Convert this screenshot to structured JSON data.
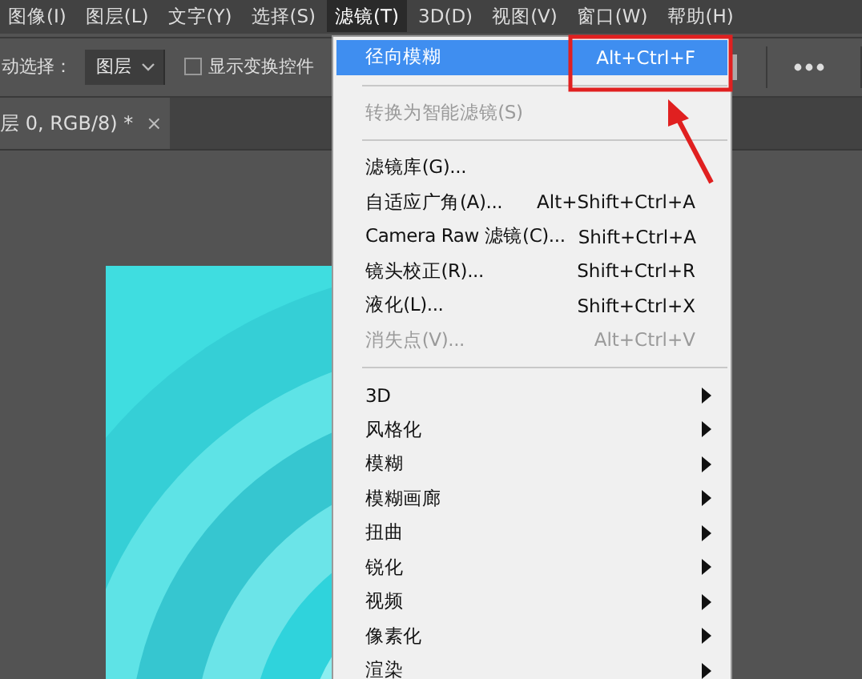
{
  "menubar": [
    {
      "label": "图像(I)",
      "selected": false
    },
    {
      "label": "图层(L)",
      "selected": false
    },
    {
      "label": "文字(Y)",
      "selected": false
    },
    {
      "label": "选择(S)",
      "selected": false
    },
    {
      "label": "滤镜(T)",
      "selected": true
    },
    {
      "label": "3D(D)",
      "selected": false
    },
    {
      "label": "视图(V)",
      "selected": false
    },
    {
      "label": "窗口(W)",
      "selected": false
    },
    {
      "label": "帮助(H)",
      "selected": false
    }
  ],
  "options_bar": {
    "label": "动选择：",
    "dropdown": "图层",
    "checkbox": {
      "label": "显示变换控件",
      "checked": false
    }
  },
  "document_tab": {
    "title": "层 0, RGB/8) *",
    "close": "×"
  },
  "filter_menu": [
    {
      "kind": "item",
      "label": "径向模糊",
      "shortcut": "Alt+Ctrl+F",
      "selected": true,
      "disabled": false
    },
    {
      "kind": "separator"
    },
    {
      "kind": "item",
      "label": "转换为智能滤镜(S)",
      "selected": false,
      "disabled": true
    },
    {
      "kind": "separator"
    },
    {
      "kind": "item",
      "label": "滤镜库(G)...",
      "selected": false,
      "disabled": false
    },
    {
      "kind": "item",
      "label": "自适应广角(A)...",
      "shortcut": "Alt+Shift+Ctrl+A",
      "selected": false,
      "disabled": false
    },
    {
      "kind": "item",
      "label": "Camera Raw 滤镜(C)...",
      "shortcut": "Shift+Ctrl+A",
      "selected": false,
      "disabled": false
    },
    {
      "kind": "item",
      "label": "镜头校正(R)...",
      "shortcut": "Shift+Ctrl+R",
      "selected": false,
      "disabled": false
    },
    {
      "kind": "item",
      "label": "液化(L)...",
      "shortcut": "Shift+Ctrl+X",
      "selected": false,
      "disabled": false
    },
    {
      "kind": "item",
      "label": "消失点(V)...",
      "shortcut": "Alt+Ctrl+V",
      "selected": false,
      "disabled": true
    },
    {
      "kind": "separator"
    },
    {
      "kind": "submenu",
      "label": "3D",
      "selected": false,
      "disabled": false
    },
    {
      "kind": "submenu",
      "label": "风格化",
      "selected": false,
      "disabled": false
    },
    {
      "kind": "submenu",
      "label": "模糊",
      "selected": false,
      "disabled": false
    },
    {
      "kind": "submenu",
      "label": "模糊画廊",
      "selected": false,
      "disabled": false
    },
    {
      "kind": "submenu",
      "label": "扭曲",
      "selected": false,
      "disabled": false
    },
    {
      "kind": "submenu",
      "label": "锐化",
      "selected": false,
      "disabled": false
    },
    {
      "kind": "submenu",
      "label": "视频",
      "selected": false,
      "disabled": false
    },
    {
      "kind": "submenu",
      "label": "像素化",
      "selected": false,
      "disabled": false
    },
    {
      "kind": "submenu",
      "label": "渲染",
      "selected": false,
      "disabled": false
    }
  ]
}
